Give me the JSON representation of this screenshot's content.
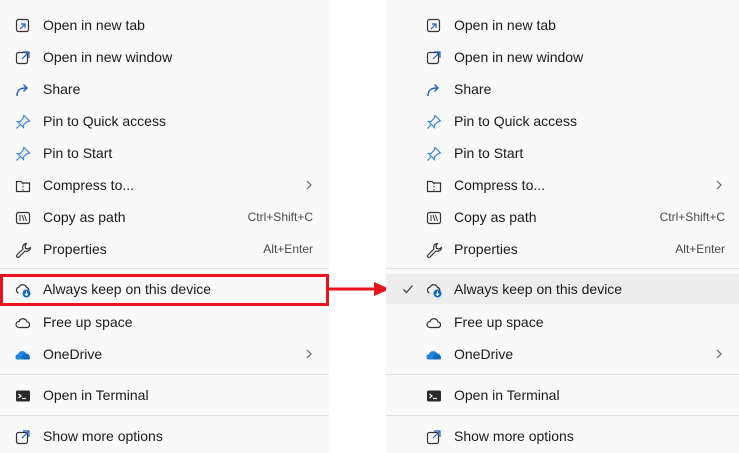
{
  "colors": {
    "highlight_box": "#e8131f",
    "arrow": "#e8131f",
    "menu_bg": "#f9f9f9",
    "selected_bg": "#ededed",
    "onedrive_blue": "#0f6cbd"
  },
  "left_menu": {
    "items": [
      {
        "label": "Open in new tab",
        "icon": "new-tab-icon"
      },
      {
        "label": "Open in new window",
        "icon": "new-window-icon"
      },
      {
        "label": "Share",
        "icon": "share-icon"
      },
      {
        "label": "Pin to Quick access",
        "icon": "pin-icon"
      },
      {
        "label": "Pin to Start",
        "icon": "pin-icon"
      },
      {
        "label": "Compress to...",
        "icon": "zip-folder-icon",
        "submenu": true
      },
      {
        "label": "Copy as path",
        "icon": "copy-path-icon",
        "shortcut": "Ctrl+Shift+C"
      },
      {
        "label": "Properties",
        "icon": "wrench-icon",
        "shortcut": "Alt+Enter"
      },
      {
        "label": "Always keep on this device",
        "icon": "cloud-download-icon",
        "highlighted": true
      },
      {
        "label": "Free up space",
        "icon": "cloud-icon"
      },
      {
        "label": "OneDrive",
        "icon": "onedrive-icon",
        "submenu": true
      },
      {
        "label": "Open in Terminal",
        "icon": "terminal-icon"
      },
      {
        "label": "Show more options",
        "icon": "more-options-icon"
      }
    ]
  },
  "right_menu": {
    "items": [
      {
        "label": "Open in new tab",
        "icon": "new-tab-icon"
      },
      {
        "label": "Open in new window",
        "icon": "new-window-icon"
      },
      {
        "label": "Share",
        "icon": "share-icon"
      },
      {
        "label": "Pin to Quick access",
        "icon": "pin-icon"
      },
      {
        "label": "Pin to Start",
        "icon": "pin-icon"
      },
      {
        "label": "Compress to...",
        "icon": "zip-folder-icon",
        "submenu": true
      },
      {
        "label": "Copy as path",
        "icon": "copy-path-icon",
        "shortcut": "Ctrl+Shift+C"
      },
      {
        "label": "Properties",
        "icon": "wrench-icon",
        "shortcut": "Alt+Enter"
      },
      {
        "label": "Always keep on this device",
        "icon": "cloud-download-icon",
        "checked": true
      },
      {
        "label": "Free up space",
        "icon": "cloud-icon"
      },
      {
        "label": "OneDrive",
        "icon": "onedrive-icon",
        "submenu": true
      },
      {
        "label": "Open in Terminal",
        "icon": "terminal-icon"
      },
      {
        "label": "Show more options",
        "icon": "more-options-icon"
      }
    ]
  }
}
